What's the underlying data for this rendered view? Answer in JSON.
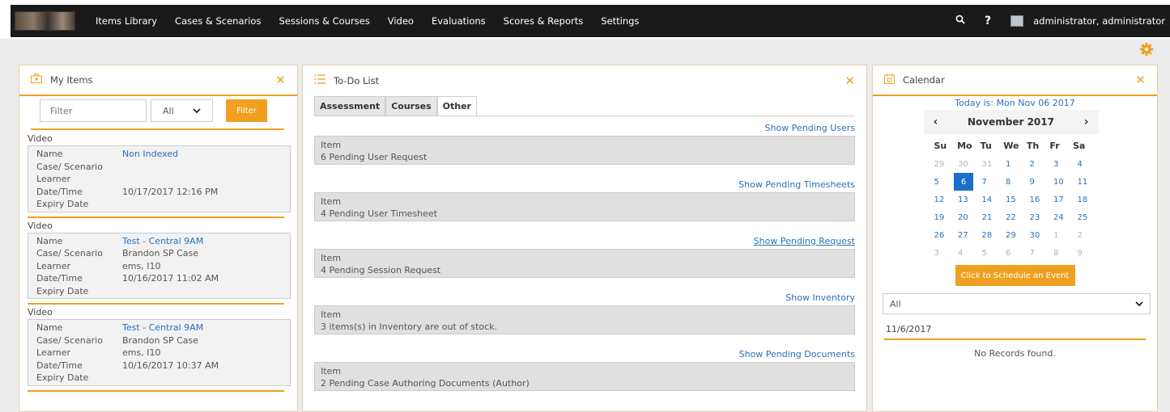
{
  "nav": {
    "items": [
      "Items Library",
      "Cases & Scenarios",
      "Sessions & Courses",
      "Video",
      "Evaluations",
      "Scores & Reports",
      "Settings"
    ],
    "search_icon": "search-icon",
    "help_label": "?",
    "user": "administrator, administrator"
  },
  "my_items": {
    "title": "My Items",
    "filter_placeholder": "Filter",
    "select_value": "All",
    "filter_button": "Filter",
    "groups": [
      {
        "type": "Video",
        "rows": [
          {
            "k": "Name",
            "v": "Non Indexed"
          },
          {
            "k": "Case/ Scenario",
            "v": ""
          },
          {
            "k": "Learner",
            "v": ""
          },
          {
            "k": "Date/Time",
            "v": "10/17/2017 12:16 PM"
          },
          {
            "k": "Expiry Date",
            "v": ""
          }
        ]
      },
      {
        "type": "Video",
        "rows": [
          {
            "k": "Name",
            "v": "Test - Central 9AM"
          },
          {
            "k": "Case/ Scenario",
            "v": "Brandon SP Case"
          },
          {
            "k": "Learner",
            "v": "ems, I10"
          },
          {
            "k": "Date/Time",
            "v": "10/16/2017 11:02 AM"
          },
          {
            "k": "Expiry Date",
            "v": ""
          }
        ]
      },
      {
        "type": "Video",
        "rows": [
          {
            "k": "Name",
            "v": "Test - Central 9AM"
          },
          {
            "k": "Case/ Scenario",
            "v": "Brandon SP Case"
          },
          {
            "k": "Learner",
            "v": "ems, I10"
          },
          {
            "k": "Date/Time",
            "v": "10/16/2017 10:37 AM"
          },
          {
            "k": "Expiry Date",
            "v": ""
          }
        ]
      }
    ]
  },
  "todo": {
    "title": "To-Do List",
    "tabs": [
      "Assessment",
      "Courses",
      "Other"
    ],
    "entries": [
      {
        "link": "Show Pending Users",
        "label": "Item",
        "text": "6 Pending User Request"
      },
      {
        "link": "Show Pending Timesheets",
        "label": "Item",
        "text": "4 Pending User Timesheet"
      },
      {
        "link": "Show Pending Request",
        "label": "Item",
        "text": "4 Pending Session Request"
      },
      {
        "link": "Show Inventory",
        "label": "Item",
        "text": "3 items(s) in Inventory are out of stock."
      },
      {
        "link": "Show Pending Documents",
        "label": "Item",
        "text": "2 Pending Case Authoring Documents (Author)"
      }
    ]
  },
  "calendar": {
    "title": "Calendar",
    "today": "Today is: Mon Nov 06 2017",
    "month": "November 2017",
    "prev": "‹",
    "next": "›",
    "dow": [
      "Su",
      "Mo",
      "Tu",
      "We",
      "Th",
      "Fr",
      "Sa"
    ],
    "days": [
      "29",
      "30",
      "31",
      "1",
      "2",
      "3",
      "4",
      "5",
      "6",
      "7",
      "8",
      "9",
      "10",
      "11",
      "12",
      "13",
      "14",
      "15",
      "16",
      "17",
      "18",
      "19",
      "20",
      "21",
      "22",
      "23",
      "24",
      "25",
      "26",
      "27",
      "28",
      "29",
      "30",
      "1",
      "2",
      "3",
      "4",
      "5",
      "6",
      "7",
      "8",
      "9"
    ],
    "schedule_button": "Click to Schedule an Event",
    "select_value": "All",
    "date": "11/6/2017",
    "no_records": "No Records found."
  },
  "colors": {
    "accent": "#f0a020",
    "link": "#2a70b8",
    "selected_day": "#1a6fc8"
  }
}
